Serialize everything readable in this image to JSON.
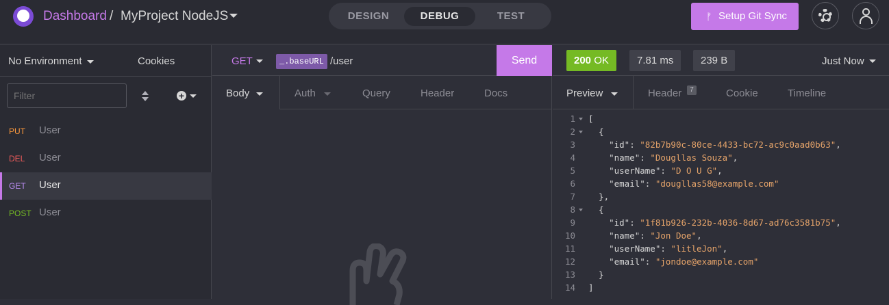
{
  "topbar": {
    "breadcrumb_root": "Dashboard",
    "breadcrumb_sep": "/",
    "project_name": "MyProject NodeJS",
    "modes": [
      "DESIGN",
      "DEBUG",
      "TEST"
    ],
    "active_mode": "DEBUG",
    "git_sync_label": "Setup Git Sync",
    "accent_color": "#c579e8"
  },
  "sidebar": {
    "environment": "No Environment",
    "cookies_label": "Cookies",
    "filter_placeholder": "Filter",
    "requests": [
      {
        "method": "PUT",
        "name": "User",
        "color": "#ff9a3c"
      },
      {
        "method": "DEL",
        "name": "User",
        "color": "#ef5b5b"
      },
      {
        "method": "GET",
        "name": "User",
        "color": "#b88cf0",
        "active": true
      },
      {
        "method": "POST",
        "name": "User",
        "color": "#75ba24"
      }
    ]
  },
  "request": {
    "method": "GET",
    "base_url_tag": "_.baseURL",
    "path": "/user",
    "send_label": "Send",
    "tabs": [
      "Body",
      "Auth",
      "Query",
      "Header",
      "Docs"
    ],
    "active_tab": "Body"
  },
  "response": {
    "status_code": "200",
    "status_text": "OK",
    "time": "7.81 ms",
    "size": "239 B",
    "when": "Just Now",
    "tabs": [
      "Preview",
      "Header",
      "Cookie",
      "Timeline"
    ],
    "active_tab": "Preview",
    "header_count": "7",
    "body_lines": [
      {
        "n": "1",
        "fold": true,
        "text": "["
      },
      {
        "n": "2",
        "fold": true,
        "text": "  {"
      },
      {
        "n": "3",
        "key": "    \"id\"",
        "value": "\"82b7b90c-80ce-4433-bc72-ac9c0aad0b63\"",
        "tail": ","
      },
      {
        "n": "4",
        "key": "    \"name\"",
        "value": "\"Dougllas Souza\"",
        "tail": ","
      },
      {
        "n": "5",
        "key": "    \"userName\"",
        "value": "\"D O U G\"",
        "tail": ","
      },
      {
        "n": "6",
        "key": "    \"email\"",
        "value": "\"dougllas58@example.com\"",
        "tail": ""
      },
      {
        "n": "7",
        "text": "  },"
      },
      {
        "n": "8",
        "fold": true,
        "text": "  {"
      },
      {
        "n": "9",
        "key": "    \"id\"",
        "value": "\"1f81b926-232b-4036-8d67-ad76c3581b75\"",
        "tail": ","
      },
      {
        "n": "10",
        "key": "    \"name\"",
        "value": "\"Jon Doe\"",
        "tail": ","
      },
      {
        "n": "11",
        "key": "    \"userName\"",
        "value": "\"litleJon\"",
        "tail": ","
      },
      {
        "n": "12",
        "key": "    \"email\"",
        "value": "\"jondoe@example.com\"",
        "tail": ""
      },
      {
        "n": "13",
        "text": "  }"
      },
      {
        "n": "14",
        "text": "]"
      }
    ]
  }
}
